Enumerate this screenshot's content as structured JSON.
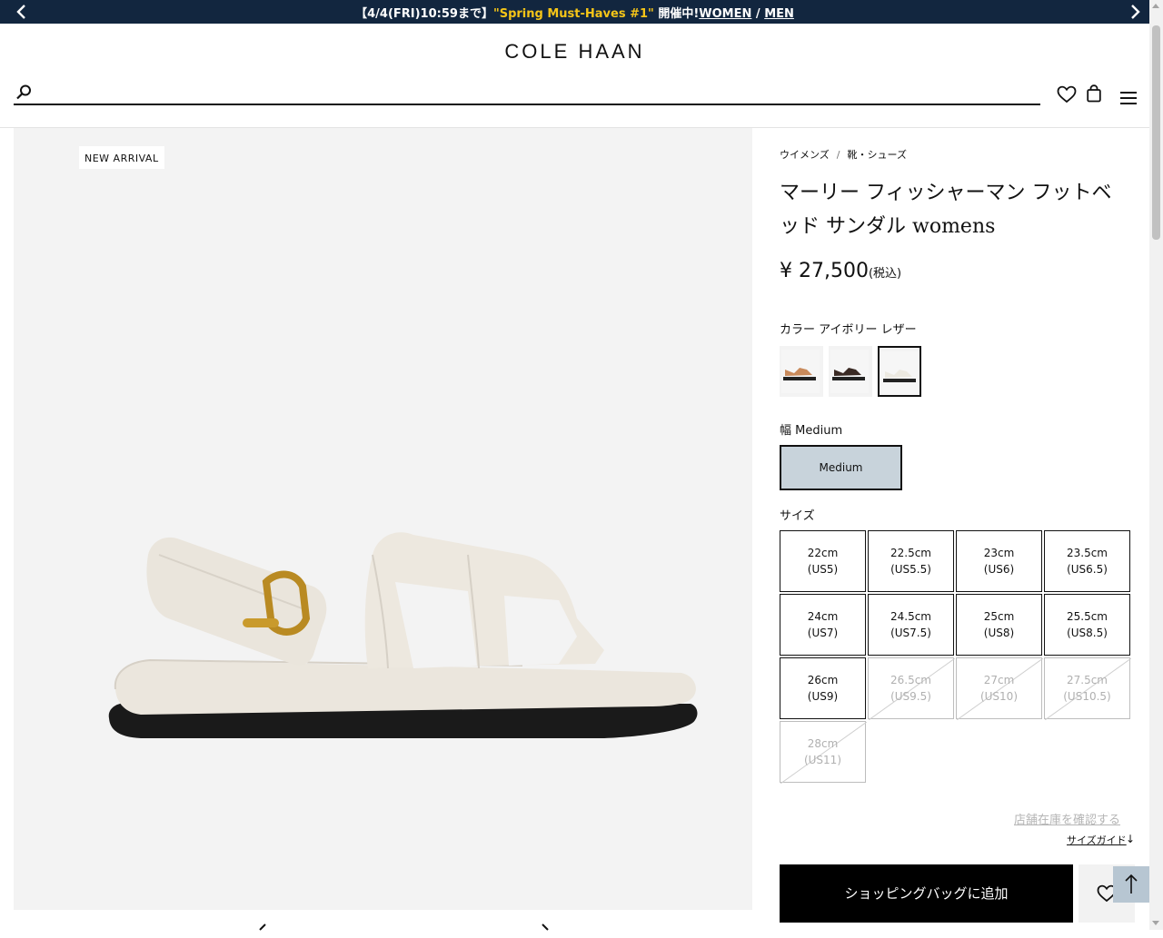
{
  "promo": {
    "prefix": "【4/4(FRI)10:59まで】",
    "highlight": "\"Spring Must-Haves #1\"",
    "suffix": " 開催中!",
    "link_women": "WOMEN",
    "sep": " / ",
    "link_men": "MEN"
  },
  "header": {
    "logo": "COLE HAAN",
    "search_placeholder": ""
  },
  "gallery": {
    "badge": "NEW ARRIVAL"
  },
  "breadcrumb": {
    "items": [
      "ウイメンズ",
      "靴・シューズ"
    ],
    "separator": "/"
  },
  "product": {
    "title": "マーリー フィッシャーマン フットベッド サンダル womens",
    "price": "¥ 27,500",
    "tax_note": "(税込)",
    "color_label": "カラー アイボリー レザー",
    "swatches": [
      {
        "name": "tan",
        "color": "#c98a5b",
        "selected": false
      },
      {
        "name": "dark-brown",
        "color": "#3a2a24",
        "selected": false
      },
      {
        "name": "ivory",
        "color": "#ece9e1",
        "selected": true
      }
    ],
    "width_label": "幅 Medium",
    "width_option": "Medium",
    "size_label": "サイズ",
    "sizes": [
      {
        "cm": "22cm",
        "us": "(US5)",
        "available": true
      },
      {
        "cm": "22.5cm",
        "us": "(US5.5)",
        "available": true
      },
      {
        "cm": "23cm",
        "us": "(US6)",
        "available": true
      },
      {
        "cm": "23.5cm",
        "us": "(US6.5)",
        "available": true
      },
      {
        "cm": "24cm",
        "us": "(US7)",
        "available": true
      },
      {
        "cm": "24.5cm",
        "us": "(US7.5)",
        "available": true
      },
      {
        "cm": "25cm",
        "us": "(US8)",
        "available": true
      },
      {
        "cm": "25.5cm",
        "us": "(US8.5)",
        "available": true
      },
      {
        "cm": "26cm",
        "us": "(US9)",
        "available": true
      },
      {
        "cm": "26.5cm",
        "us": "(US9.5)",
        "available": false
      },
      {
        "cm": "27cm",
        "us": "(US10)",
        "available": false
      },
      {
        "cm": "27.5cm",
        "us": "(US10.5)",
        "available": false
      },
      {
        "cm": "28cm",
        "us": "(US11)",
        "available": false
      }
    ],
    "store_stock_link": "店舗在庫を確認する",
    "size_guide_link": "サイズガイド",
    "size_guide_arrow": "↓",
    "add_to_bag": "ショッピングバッグに追加"
  },
  "icons": {
    "search": "search-icon",
    "wishlist": "heart-icon",
    "bag": "shopping-bag-icon",
    "menu": "hamburger-menu-icon",
    "back_to_top": "arrow-up-icon"
  },
  "colors": {
    "promo_bg": "#12263f",
    "promo_highlight": "#f5c518",
    "selected_width_bg": "#c8d3db",
    "back_to_top_bg": "#b7c6d2"
  }
}
